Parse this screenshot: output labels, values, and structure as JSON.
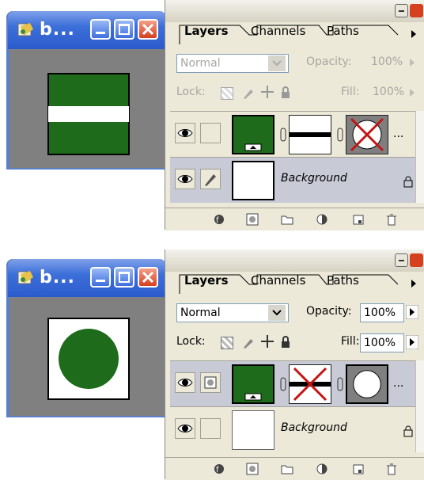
{
  "doc_window": {
    "title": "b...",
    "icon": "photoshop-doc-icon",
    "buttons": [
      "minimize-icon",
      "maximize-icon",
      "close-icon"
    ]
  },
  "panel": {
    "tabs": [
      "Layers",
      "Channels",
      "Paths"
    ],
    "blend_mode": "Normal",
    "opacity_label": "Opacity:",
    "opacity_value": "100%",
    "lock_label": "Lock:",
    "fill_label": "Fill:",
    "fill_value": "100%",
    "background_layer_name": "Background",
    "more": "..."
  },
  "colors": {
    "dark_green": "#1e6b1c",
    "title_blue": "#2b5bcc",
    "close_red": "#d5401f",
    "panel_bg": "#ece9d8"
  }
}
